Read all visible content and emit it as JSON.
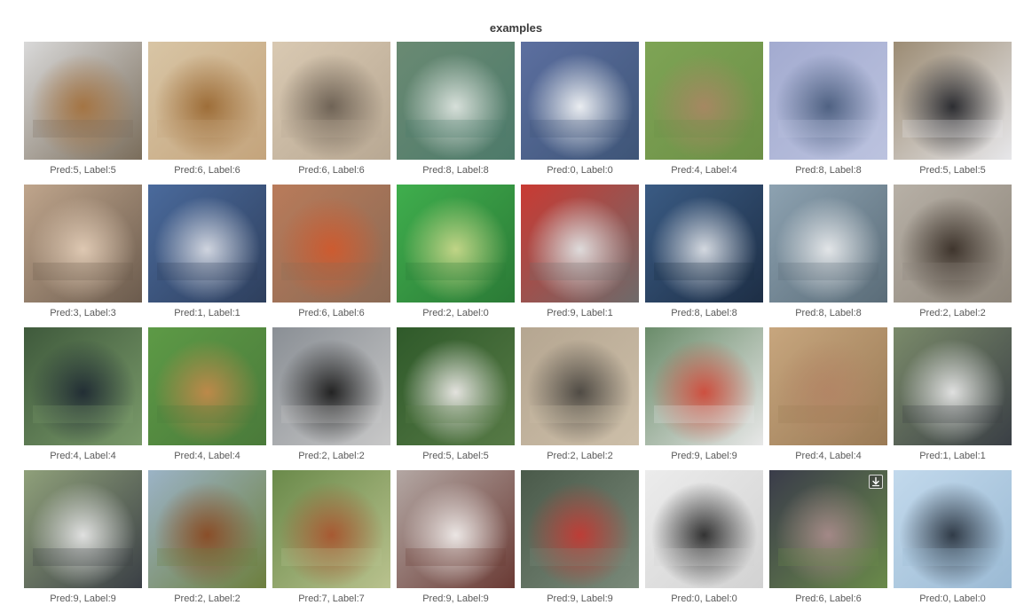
{
  "panel": {
    "title": "examples"
  },
  "images": [
    {
      "caption": "Pred:5, Label:5",
      "colors": [
        "#d9d9d9",
        "#a4723f",
        "#7a6d5b"
      ]
    },
    {
      "caption": "Pred:6, Label:6",
      "colors": [
        "#d8c5a5",
        "#9b6a34",
        "#c4a47c"
      ]
    },
    {
      "caption": "Pred:6, Label:6",
      "colors": [
        "#d9c9b2",
        "#6b5f52",
        "#b8a893"
      ]
    },
    {
      "caption": "Pred:8, Label:8",
      "colors": [
        "#6a8a73",
        "#dde4df",
        "#4d7a6a"
      ]
    },
    {
      "caption": "Pred:0, Label:0",
      "colors": [
        "#5c6fa0",
        "#f2f4f6",
        "#3e5577"
      ]
    },
    {
      "caption": "Pred:4, Label:4",
      "colors": [
        "#7ea455",
        "#a88763",
        "#6c8f46"
      ]
    },
    {
      "caption": "Pred:8, Label:8",
      "colors": [
        "#a3abd0",
        "#4a5d7e",
        "#bcc3df"
      ]
    },
    {
      "caption": "Pred:5, Label:5",
      "colors": [
        "#9c8c74",
        "#25262b",
        "#e7e7ea"
      ]
    },
    {
      "caption": "Pred:3, Label:3",
      "colors": [
        "#bfa58c",
        "#e2ccb6",
        "#6b5b4d"
      ]
    },
    {
      "caption": "Pred:1, Label:1",
      "colors": [
        "#4a6a9c",
        "#d7dbe4",
        "#2e3f5d"
      ]
    },
    {
      "caption": "Pred:6, Label:6",
      "colors": [
        "#b97b5a",
        "#cf5a2e",
        "#8a6a55"
      ]
    },
    {
      "caption": "Pred:2, Label:0",
      "colors": [
        "#3fae4d",
        "#c8d88a",
        "#2b7a36"
      ]
    },
    {
      "caption": "Pred:9, Label:1",
      "colors": [
        "#c93a33",
        "#e2e2e2",
        "#6e6a6a"
      ]
    },
    {
      "caption": "Pred:8, Label:8",
      "colors": [
        "#3a5b84",
        "#dce0e6",
        "#1d2e45"
      ]
    },
    {
      "caption": "Pred:8, Label:8",
      "colors": [
        "#8da2b1",
        "#e8eaec",
        "#5a6c78"
      ]
    },
    {
      "caption": "Pred:2, Label:2",
      "colors": [
        "#b7b0a6",
        "#3a3028",
        "#8d857a"
      ]
    },
    {
      "caption": "Pred:4, Label:4",
      "colors": [
        "#3f5a3c",
        "#1f2a33",
        "#7a9a6a"
      ]
    },
    {
      "caption": "Pred:4, Label:4",
      "colors": [
        "#5d9a46",
        "#c2894a",
        "#4a7a3a"
      ]
    },
    {
      "caption": "Pred:2, Label:2",
      "colors": [
        "#8a8f95",
        "#1c1c1c",
        "#c8c8c8"
      ]
    },
    {
      "caption": "Pred:5, Label:5",
      "colors": [
        "#2f5a2a",
        "#ebe8e6",
        "#577a46"
      ]
    },
    {
      "caption": "Pred:2, Label:2",
      "colors": [
        "#b5a691",
        "#4a4640",
        "#cdbfa9"
      ]
    },
    {
      "caption": "Pred:9, Label:9",
      "colors": [
        "#6a8c6a",
        "#cf4a3a",
        "#e8e8e8"
      ]
    },
    {
      "caption": "Pred:4, Label:4",
      "colors": [
        "#c7a67e",
        "#b38565",
        "#9a7a55"
      ]
    },
    {
      "caption": "Pred:1, Label:1",
      "colors": [
        "#7a8a6a",
        "#e6e6e6",
        "#3a3f45"
      ]
    },
    {
      "caption": "Pred:9, Label:9",
      "colors": [
        "#8fa07a",
        "#e6e6e6",
        "#3a3f45"
      ]
    },
    {
      "caption": "Pred:2, Label:2",
      "colors": [
        "#9bb3c6",
        "#8a4a24",
        "#6d7f3e"
      ]
    },
    {
      "caption": "Pred:7, Label:7",
      "colors": [
        "#6a8a4a",
        "#a8552f",
        "#b9c28e"
      ]
    },
    {
      "caption": "Pred:9, Label:9",
      "colors": [
        "#b3a7a3",
        "#f0ecea",
        "#6a3a34"
      ]
    },
    {
      "caption": "Pred:9, Label:9",
      "colors": [
        "#4a5a4a",
        "#c23a34",
        "#7a8a7a"
      ]
    },
    {
      "caption": "Pred:0, Label:0",
      "colors": [
        "#ececec",
        "#2a2a2a",
        "#d2d2d2"
      ]
    },
    {
      "caption": "Pred:6, Label:6",
      "colors": [
        "#3a3c4a",
        "#a78a8a",
        "#6a8a4a"
      ]
    },
    {
      "caption": "Pred:0, Label:0",
      "colors": [
        "#c2d9ec",
        "#2a3440",
        "#9bbad4"
      ]
    }
  ]
}
